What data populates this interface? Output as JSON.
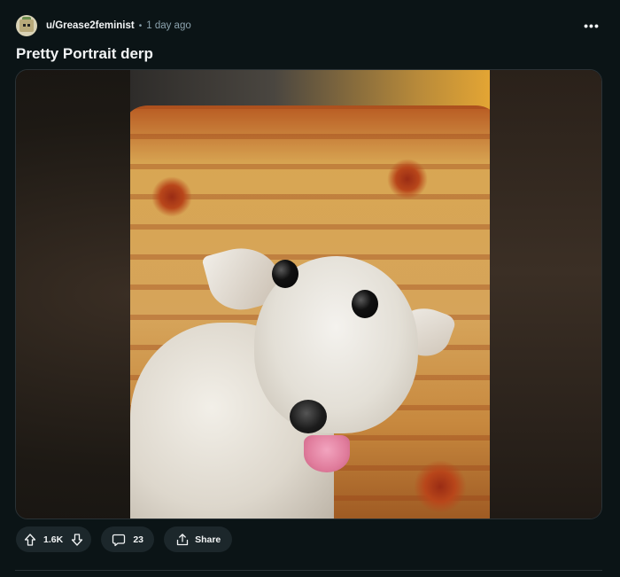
{
  "post": {
    "author": "u/Grease2feminist",
    "separator": "•",
    "timestamp": "1 day ago",
    "more_label": "•••",
    "title": "Pretty Portrait derp"
  },
  "media": {
    "description_icon": "photo-of-small-white-chihuahua"
  },
  "actions": {
    "vote_count": "1.6K",
    "comment_count": "23",
    "share_label": "Share"
  },
  "icons": {
    "upvote": "arrow-up-icon",
    "downvote": "arrow-down-icon",
    "comments": "comment-bubble-icon",
    "share": "share-icon",
    "more": "more-options-icon"
  },
  "colors": {
    "background": "#0b1416",
    "pill": "#1c272b",
    "muted_text": "#8ba2ad",
    "text": "#f2f4f5"
  }
}
